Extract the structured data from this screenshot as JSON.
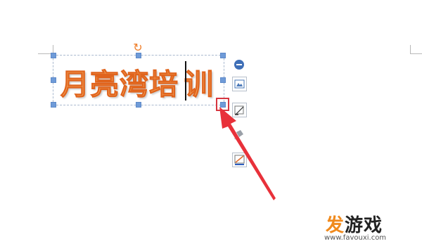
{
  "wordart": {
    "text_left": "月亮湾培",
    "text_right": "训"
  },
  "toolbar": {
    "items": [
      {
        "icon": "minus-icon"
      },
      {
        "icon": "layout-options-icon"
      },
      {
        "icon": "edit-shape-icon"
      },
      {
        "icon": "fill-bucket-icon"
      },
      {
        "icon": "outline-color-icon"
      }
    ]
  },
  "annotation": {
    "color": "#e8313a"
  },
  "watermark": {
    "title_accent": "发",
    "title_rest": "游戏",
    "url": "www.favouxi.com"
  }
}
